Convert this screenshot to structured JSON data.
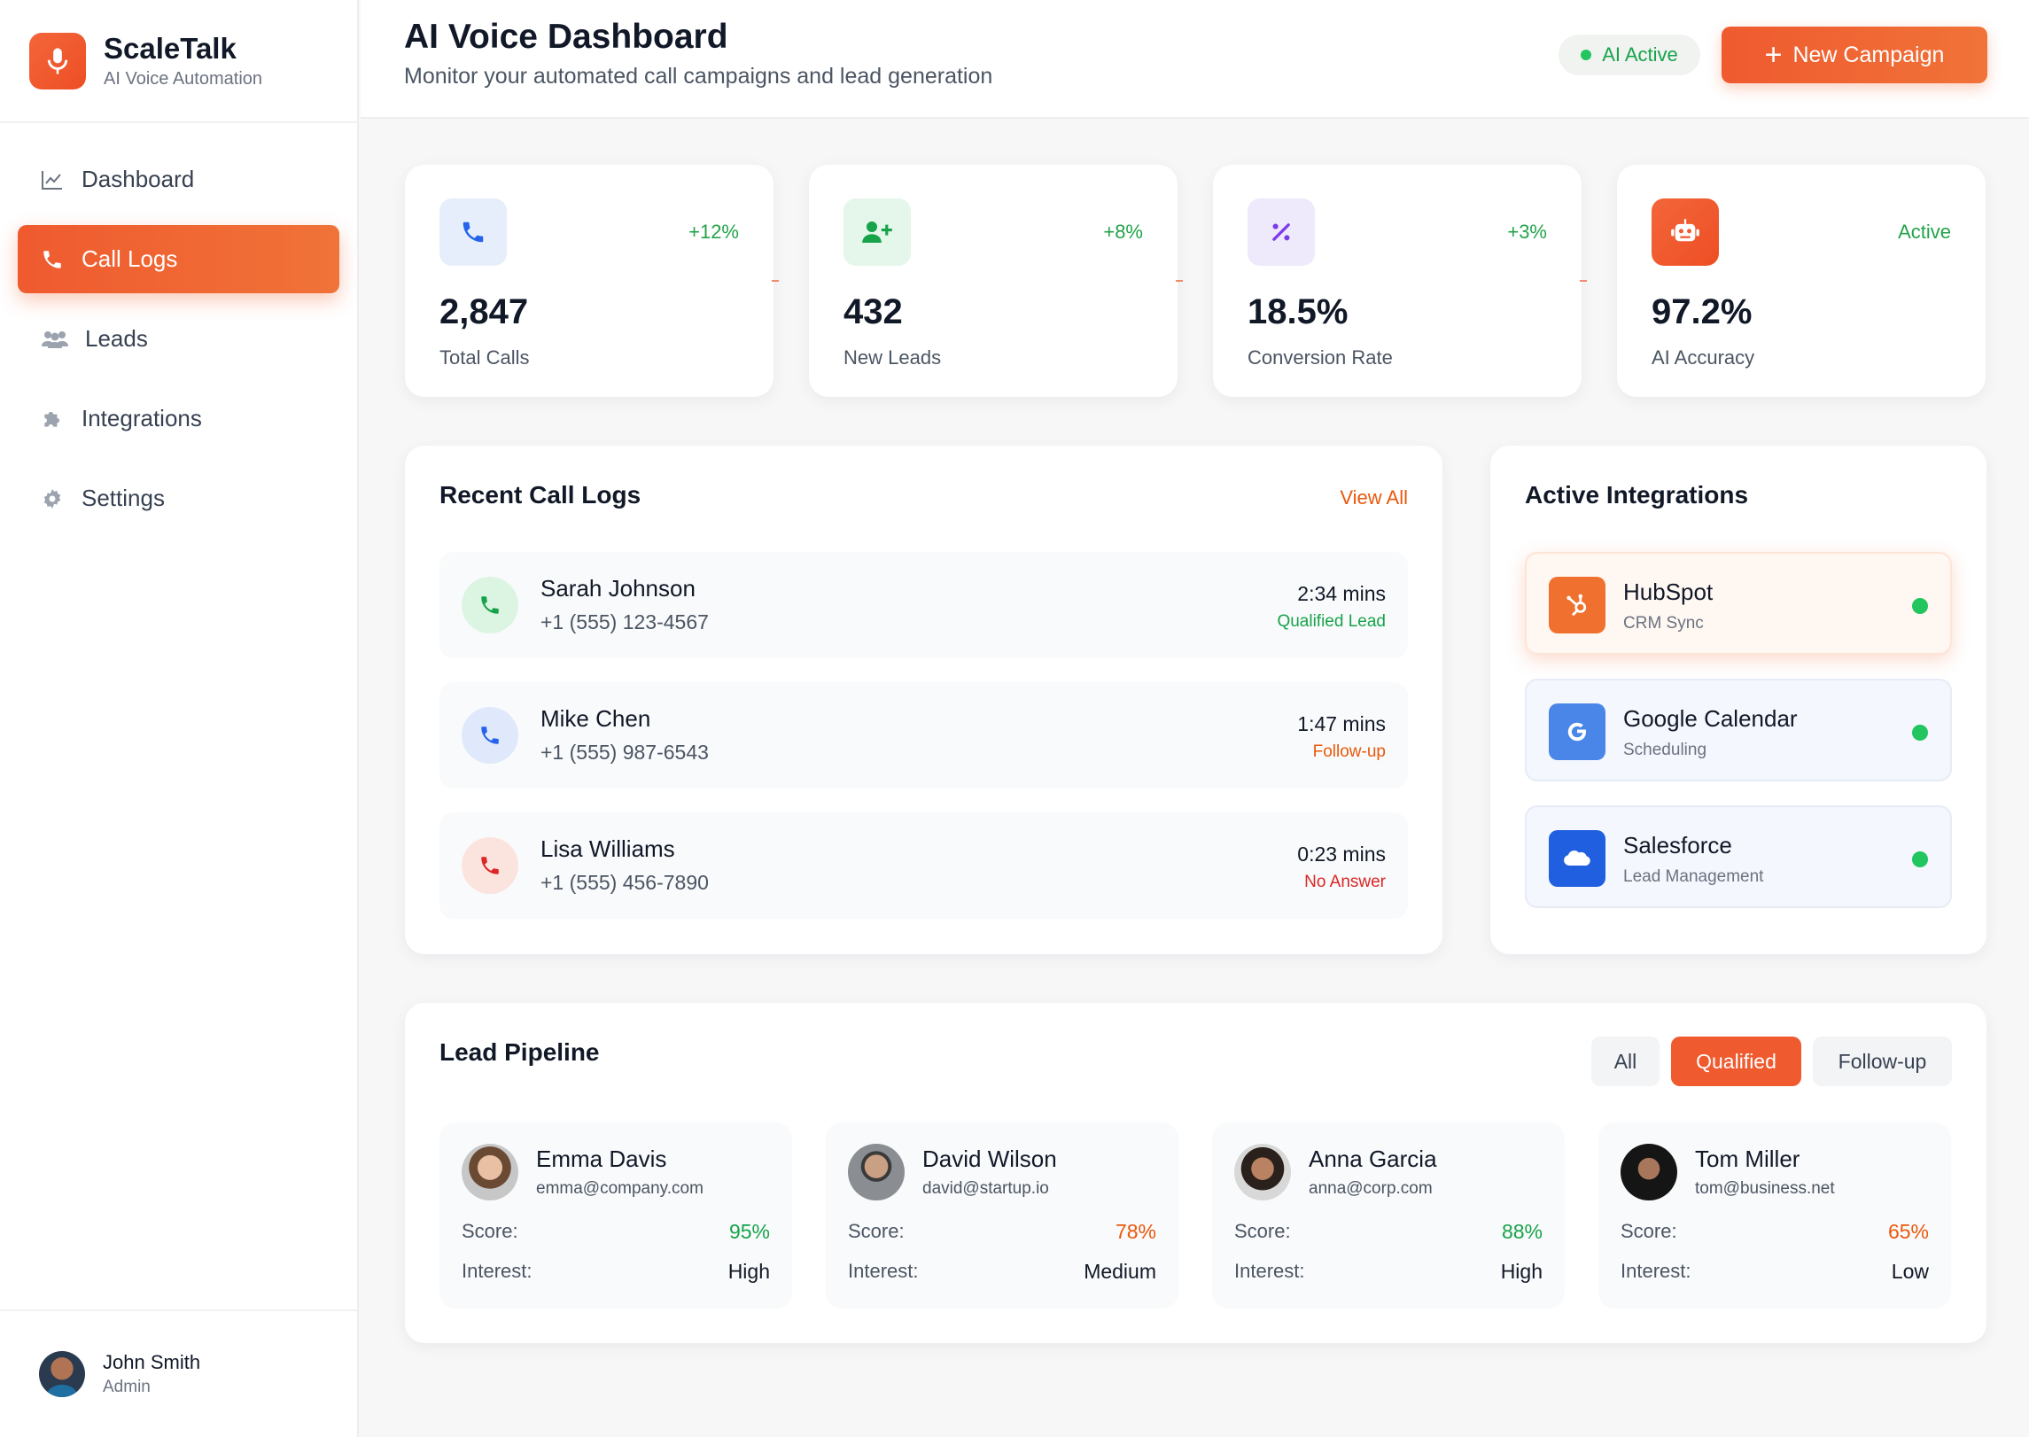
{
  "brand": {
    "name": "ScaleTalk",
    "subtitle": "AI Voice Automation",
    "logo_icon": "microphone-icon"
  },
  "nav": [
    {
      "label": "Dashboard",
      "icon": "chart-line-icon",
      "active": false
    },
    {
      "label": "Call Logs",
      "icon": "phone-icon",
      "active": true
    },
    {
      "label": "Leads",
      "icon": "users-icon",
      "active": false
    },
    {
      "label": "Integrations",
      "icon": "puzzle-icon",
      "active": false
    },
    {
      "label": "Settings",
      "icon": "gear-icon",
      "active": false
    }
  ],
  "user": {
    "name": "John Smith",
    "role": "Admin"
  },
  "header": {
    "title": "AI Voice Dashboard",
    "subtitle": "Monitor your automated call campaigns and lead generation",
    "status": "AI Active",
    "new_campaign": "New Campaign"
  },
  "stats": [
    {
      "value": "2,847",
      "label": "Total Calls",
      "change": "+12%",
      "icon": "phone-icon"
    },
    {
      "value": "432",
      "label": "New Leads",
      "change": "+8%",
      "icon": "user-plus-icon"
    },
    {
      "value": "18.5%",
      "label": "Conversion Rate",
      "change": "+3%",
      "icon": "percent-icon"
    },
    {
      "value": "97.2%",
      "label": "AI Accuracy",
      "change": "Active",
      "icon": "robot-icon"
    }
  ],
  "calls": {
    "title": "Recent Call Logs",
    "view_all": "View All",
    "items": [
      {
        "name": "Sarah Johnson",
        "phone": "+1 (555) 123-4567",
        "duration": "2:34 mins",
        "status": "Qualified Lead",
        "status_color": "#16a34a"
      },
      {
        "name": "Mike Chen",
        "phone": "+1 (555) 987-6543",
        "duration": "1:47 mins",
        "status": "Follow-up",
        "status_color": "#ea580c"
      },
      {
        "name": "Lisa Williams",
        "phone": "+1 (555) 456-7890",
        "duration": "0:23 mins",
        "status": "No Answer",
        "status_color": "#dc2626"
      }
    ]
  },
  "integrations": {
    "title": "Active Integrations",
    "items": [
      {
        "name": "HubSpot",
        "sub": "CRM Sync",
        "icon": "hubspot-icon"
      },
      {
        "name": "Google Calendar",
        "sub": "Scheduling",
        "icon": "google-icon"
      },
      {
        "name": "Salesforce",
        "sub": "Lead Management",
        "icon": "salesforce-icon"
      }
    ]
  },
  "pipeline": {
    "title": "Lead Pipeline",
    "filters": [
      "All",
      "Qualified",
      "Follow-up"
    ],
    "active_filter": "Qualified",
    "score_label": "Score:",
    "interest_label": "Interest:",
    "leads": [
      {
        "name": "Emma Davis",
        "email": "emma@company.com",
        "score": "95%",
        "score_color": "#16a34a",
        "interest": "High"
      },
      {
        "name": "David Wilson",
        "email": "david@startup.io",
        "score": "78%",
        "score_color": "#ea580c",
        "interest": "Medium"
      },
      {
        "name": "Anna Garcia",
        "email": "anna@corp.com",
        "score": "88%",
        "score_color": "#16a34a",
        "interest": "High"
      },
      {
        "name": "Tom Miller",
        "email": "tom@business.net",
        "score": "65%",
        "score_color": "#ea580c",
        "interest": "Low"
      }
    ]
  },
  "colors": {
    "accent": "#ef5a2f",
    "success": "#16a34a",
    "warning": "#ea580c",
    "danger": "#dc2626"
  }
}
